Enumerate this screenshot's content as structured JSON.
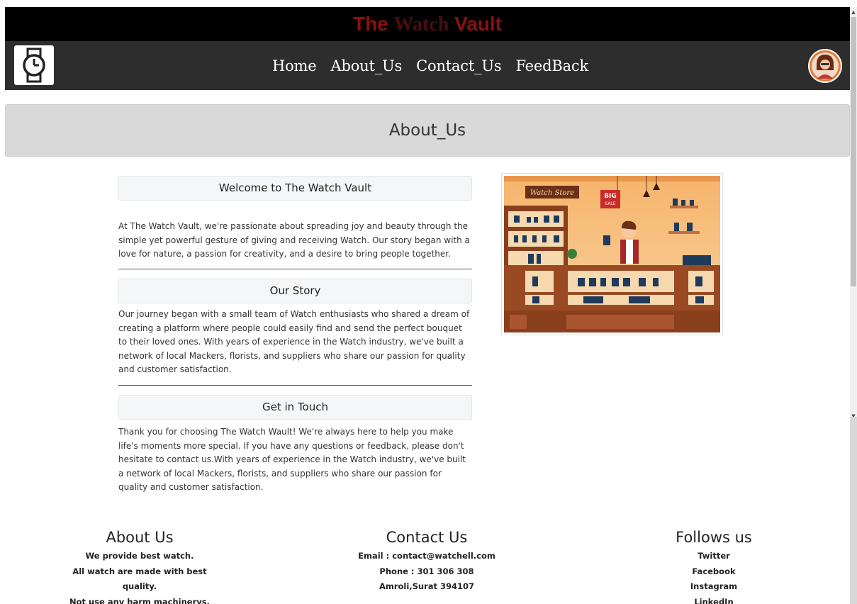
{
  "brand": {
    "part1": "The ",
    "part2": "Watch",
    "part3": " Vault"
  },
  "nav": {
    "home": "Home",
    "about": "About_Us",
    "contact": "Contact_Us",
    "feedback": "FeedBack"
  },
  "icons": {
    "logo": "watch-icon",
    "avatar": "user-avatar-icon"
  },
  "hero": {
    "title": "About_Us"
  },
  "sections": {
    "welcome": {
      "heading": "Welcome to The Watch Vault",
      "text": "At The Watch Vault, we're passionate about spreading joy and beauty through the simple yet powerful gesture of giving and receiving Watch. Our story began with a love for nature, a passion for creativity, and a desire to bring people together."
    },
    "story": {
      "heading": "Our Story",
      "text": "Our journey began with a small team of Watch enthusiasts who shared a dream of creating a platform where people could easily find and send the perfect bouquet to their loved ones. With years of experience in the Watch industry, we've built a network of local Mackers, florists, and suppliers who share our passion for quality and customer satisfaction."
    },
    "touch": {
      "heading": "Get in Touch",
      "text": "Thank you for choosing The Watch Wault! We're always here to help you make life's moments more special. If you have any questions or feedback, please don't hesitate to contact us.With years of experience in the Watch industry, we've built a network of local Mackers, florists, and suppliers who share our passion for quality and customer satisfaction."
    }
  },
  "store_image": {
    "sign": "Watch Store",
    "badge_line1": "BIG",
    "badge_line2": "SALE"
  },
  "footer": {
    "about": {
      "title": "About Us",
      "lines": [
        "We provide best watch.",
        "All watch are made with best quality.",
        "Not use any harm machinerys."
      ]
    },
    "contact": {
      "title": "Contact Us",
      "lines": [
        "Email : contact@watchell.com",
        "Phone : 301 306 308",
        "Amroli,Surat 394107"
      ]
    },
    "follow": {
      "title": "Follows us",
      "links": [
        "Twitter",
        "Facebook",
        "Instagram",
        "LinkedIn"
      ]
    }
  },
  "colors": {
    "topbar": "#000000",
    "navbar": "#2d2d2d",
    "brand": "#8b1010",
    "hero": "#d9d9d9"
  }
}
